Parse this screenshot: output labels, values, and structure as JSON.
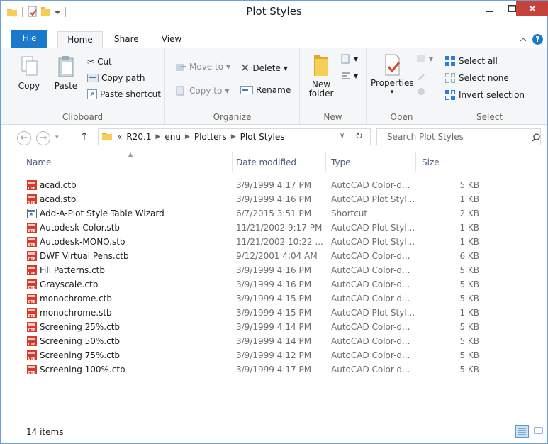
{
  "window": {
    "title": "Plot Styles"
  },
  "ribbon_tabs": [
    "File",
    "Home",
    "Share",
    "View"
  ],
  "ribbon": {
    "clipboard": {
      "label": "Clipboard",
      "copy": "Copy",
      "paste": "Paste",
      "cut": "Cut",
      "copy_path": "Copy path",
      "paste_shortcut": "Paste shortcut"
    },
    "organize": {
      "label": "Organize",
      "move_to": "Move to",
      "copy_to": "Copy to",
      "delete": "Delete",
      "rename": "Rename"
    },
    "new": {
      "label": "New",
      "new_folder_line1": "New",
      "new_folder_line2": "folder"
    },
    "open": {
      "label": "Open",
      "properties": "Properties"
    },
    "select": {
      "label": "Select",
      "select_all": "Select all",
      "select_none": "Select none",
      "invert_selection": "Invert selection"
    }
  },
  "address": {
    "overflow": "«",
    "crumbs": [
      "R20.1",
      "enu",
      "Plotters",
      "Plot Styles"
    ]
  },
  "search": {
    "placeholder": "Search Plot Styles"
  },
  "columns": {
    "name": "Name",
    "date": "Date modified",
    "type": "Type",
    "size": "Size"
  },
  "files": [
    {
      "name": "acad.ctb",
      "date": "3/9/1999 4:17 PM",
      "type": "AutoCAD Color-d...",
      "size": "5 KB",
      "icon": "ctb"
    },
    {
      "name": "acad.stb",
      "date": "3/9/1999 4:16 PM",
      "type": "AutoCAD Plot Styl...",
      "size": "1 KB",
      "icon": "stb"
    },
    {
      "name": "Add-A-Plot Style Table Wizard",
      "date": "6/7/2015 3:51 PM",
      "type": "Shortcut",
      "size": "2 KB",
      "icon": "shortcut"
    },
    {
      "name": "Autodesk-Color.stb",
      "date": "11/21/2002 9:17 PM",
      "type": "AutoCAD Plot Styl...",
      "size": "1 KB",
      "icon": "stb"
    },
    {
      "name": "Autodesk-MONO.stb",
      "date": "11/21/2002 10:22 ...",
      "type": "AutoCAD Plot Styl...",
      "size": "1 KB",
      "icon": "stb"
    },
    {
      "name": "DWF Virtual Pens.ctb",
      "date": "9/12/2001 4:04 AM",
      "type": "AutoCAD Color-d...",
      "size": "6 KB",
      "icon": "ctb"
    },
    {
      "name": "Fill Patterns.ctb",
      "date": "3/9/1999 4:16 PM",
      "type": "AutoCAD Color-d...",
      "size": "5 KB",
      "icon": "ctb"
    },
    {
      "name": "Grayscale.ctb",
      "date": "3/9/1999 4:16 PM",
      "type": "AutoCAD Color-d...",
      "size": "5 KB",
      "icon": "ctb"
    },
    {
      "name": "monochrome.ctb",
      "date": "3/9/1999 4:15 PM",
      "type": "AutoCAD Color-d...",
      "size": "5 KB",
      "icon": "ctb"
    },
    {
      "name": "monochrome.stb",
      "date": "3/9/1999 4:15 PM",
      "type": "AutoCAD Plot Styl...",
      "size": "1 KB",
      "icon": "stb"
    },
    {
      "name": "Screening 25%.ctb",
      "date": "3/9/1999 4:14 PM",
      "type": "AutoCAD Color-d...",
      "size": "5 KB",
      "icon": "ctb"
    },
    {
      "name": "Screening 50%.ctb",
      "date": "3/9/1999 4:14 PM",
      "type": "AutoCAD Color-d...",
      "size": "5 KB",
      "icon": "ctb"
    },
    {
      "name": "Screening 75%.ctb",
      "date": "3/9/1999 4:12 PM",
      "type": "AutoCAD Color-d...",
      "size": "5 KB",
      "icon": "ctb"
    },
    {
      "name": "Screening 100%.ctb",
      "date": "3/9/1999 4:17 PM",
      "type": "AutoCAD Color-d...",
      "size": "5 KB",
      "icon": "ctb"
    }
  ],
  "status": {
    "item_count": "14 items"
  },
  "colors": {
    "accent": "#1979ca",
    "close": "#c7423a",
    "file_icon_red": "#d53b2b"
  }
}
